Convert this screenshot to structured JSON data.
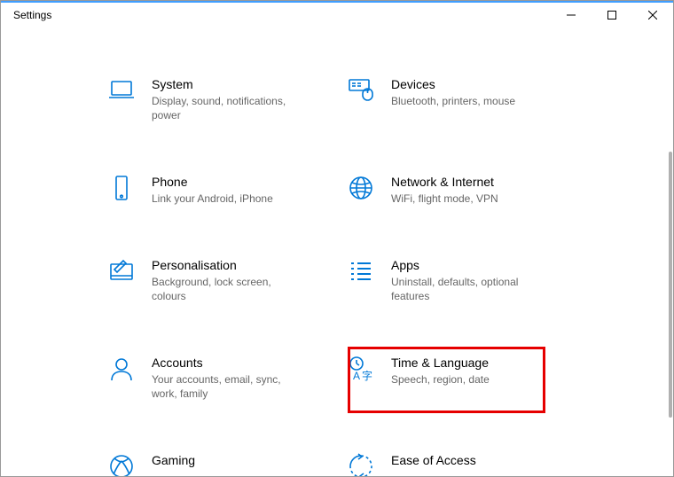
{
  "window": {
    "title": "Settings"
  },
  "categories": [
    {
      "title": "System",
      "desc": "Display, sound, notifications, power"
    },
    {
      "title": "Devices",
      "desc": "Bluetooth, printers, mouse"
    },
    {
      "title": "Phone",
      "desc": "Link your Android, iPhone"
    },
    {
      "title": "Network & Internet",
      "desc": "WiFi, flight mode, VPN"
    },
    {
      "title": "Personalisation",
      "desc": "Background, lock screen, colours"
    },
    {
      "title": "Apps",
      "desc": "Uninstall, defaults, optional features"
    },
    {
      "title": "Accounts",
      "desc": "Your accounts, email, sync, work, family"
    },
    {
      "title": "Time & Language",
      "desc": "Speech, region, date"
    },
    {
      "title": "Gaming",
      "desc": ""
    },
    {
      "title": "Ease of Access",
      "desc": ""
    }
  ]
}
